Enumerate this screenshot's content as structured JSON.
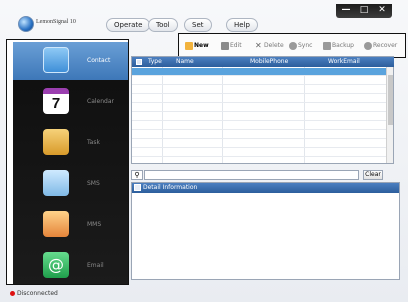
{
  "app": {
    "name": "LemonSignal 10"
  },
  "menu": [
    {
      "label": "Operate"
    },
    {
      "label": "Tool"
    },
    {
      "label": "Set"
    },
    {
      "label": "Help"
    }
  ],
  "window_controls": {
    "minimize": "—",
    "maximize": "□",
    "close": "✕"
  },
  "toolbar": {
    "new_label": "New",
    "edit_label": "Edit",
    "delete_label": "Delete",
    "sync_label": "Sync",
    "backup_label": "Backup",
    "recover_label": "Recover"
  },
  "sidebar": {
    "items": [
      {
        "label": "Contact",
        "icon": "contact-icon",
        "color": "#4fa3e8"
      },
      {
        "label": "Calendar",
        "icon": "calendar-icon",
        "color": "#ffffff"
      },
      {
        "label": "Task",
        "icon": "task-icon",
        "color": "#e8b84a"
      },
      {
        "label": "SMS",
        "icon": "sms-icon",
        "color": "#9fd0f0"
      },
      {
        "label": "MMS",
        "icon": "mms-icon",
        "color": "#f0a75a"
      },
      {
        "label": "Email",
        "icon": "email-icon",
        "color": "#3cc16a"
      }
    ],
    "calendar_day": "7"
  },
  "grid": {
    "columns": [
      "Type",
      "Name",
      "MobilePhone",
      "WorkEmail"
    ],
    "row_count": 12
  },
  "search": {
    "placeholder": "",
    "clear_label": "Clear"
  },
  "detail": {
    "title": "Detail Information"
  },
  "status": {
    "text": "Disconnected",
    "color": "#d11111"
  },
  "accent": "#3d77b8"
}
